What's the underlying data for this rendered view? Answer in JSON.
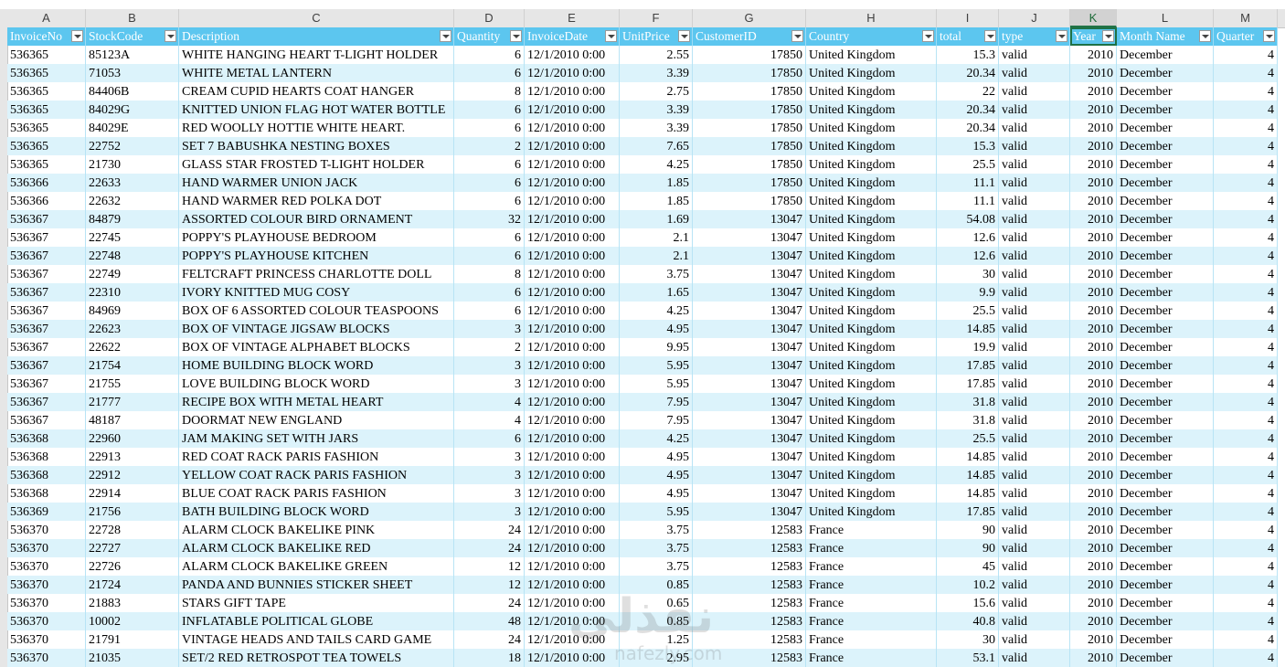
{
  "column_letters": [
    "A",
    "B",
    "C",
    "D",
    "E",
    "F",
    "G",
    "H",
    "I",
    "J",
    "K",
    "L",
    "M"
  ],
  "selected_column": "K",
  "headers": [
    "InvoiceNo",
    "StockCode",
    "Description",
    "Quantity",
    "InvoiceDate",
    "UnitPrice",
    "CustomerID",
    "Country",
    "total",
    "type",
    "Year",
    "Month Name",
    "Quarter"
  ],
  "rows": [
    [
      "536365",
      "85123A",
      "WHITE HANGING HEART T-LIGHT HOLDER",
      "6",
      "12/1/2010 0:00",
      "2.55",
      "17850",
      "United Kingdom",
      "15.3",
      "valid",
      "2010",
      "December",
      "4"
    ],
    [
      "536365",
      "71053",
      "WHITE METAL LANTERN",
      "6",
      "12/1/2010 0:00",
      "3.39",
      "17850",
      "United Kingdom",
      "20.34",
      "valid",
      "2010",
      "December",
      "4"
    ],
    [
      "536365",
      "84406B",
      "CREAM CUPID HEARTS COAT HANGER",
      "8",
      "12/1/2010 0:00",
      "2.75",
      "17850",
      "United Kingdom",
      "22",
      "valid",
      "2010",
      "December",
      "4"
    ],
    [
      "536365",
      "84029G",
      "KNITTED UNION FLAG HOT WATER BOTTLE",
      "6",
      "12/1/2010 0:00",
      "3.39",
      "17850",
      "United Kingdom",
      "20.34",
      "valid",
      "2010",
      "December",
      "4"
    ],
    [
      "536365",
      "84029E",
      "RED WOOLLY HOTTIE WHITE HEART.",
      "6",
      "12/1/2010 0:00",
      "3.39",
      "17850",
      "United Kingdom",
      "20.34",
      "valid",
      "2010",
      "December",
      "4"
    ],
    [
      "536365",
      "22752",
      "SET 7 BABUSHKA NESTING BOXES",
      "2",
      "12/1/2010 0:00",
      "7.65",
      "17850",
      "United Kingdom",
      "15.3",
      "valid",
      "2010",
      "December",
      "4"
    ],
    [
      "536365",
      "21730",
      "GLASS STAR FROSTED T-LIGHT HOLDER",
      "6",
      "12/1/2010 0:00",
      "4.25",
      "17850",
      "United Kingdom",
      "25.5",
      "valid",
      "2010",
      "December",
      "4"
    ],
    [
      "536366",
      "22633",
      "HAND WARMER UNION JACK",
      "6",
      "12/1/2010 0:00",
      "1.85",
      "17850",
      "United Kingdom",
      "11.1",
      "valid",
      "2010",
      "December",
      "4"
    ],
    [
      "536366",
      "22632",
      "HAND WARMER RED POLKA DOT",
      "6",
      "12/1/2010 0:00",
      "1.85",
      "17850",
      "United Kingdom",
      "11.1",
      "valid",
      "2010",
      "December",
      "4"
    ],
    [
      "536367",
      "84879",
      "ASSORTED COLOUR BIRD ORNAMENT",
      "32",
      "12/1/2010 0:00",
      "1.69",
      "13047",
      "United Kingdom",
      "54.08",
      "valid",
      "2010",
      "December",
      "4"
    ],
    [
      "536367",
      "22745",
      "POPPY'S PLAYHOUSE BEDROOM",
      "6",
      "12/1/2010 0:00",
      "2.1",
      "13047",
      "United Kingdom",
      "12.6",
      "valid",
      "2010",
      "December",
      "4"
    ],
    [
      "536367",
      "22748",
      "POPPY'S PLAYHOUSE KITCHEN",
      "6",
      "12/1/2010 0:00",
      "2.1",
      "13047",
      "United Kingdom",
      "12.6",
      "valid",
      "2010",
      "December",
      "4"
    ],
    [
      "536367",
      "22749",
      "FELTCRAFT PRINCESS CHARLOTTE DOLL",
      "8",
      "12/1/2010 0:00",
      "3.75",
      "13047",
      "United Kingdom",
      "30",
      "valid",
      "2010",
      "December",
      "4"
    ],
    [
      "536367",
      "22310",
      "IVORY KNITTED MUG COSY",
      "6",
      "12/1/2010 0:00",
      "1.65",
      "13047",
      "United Kingdom",
      "9.9",
      "valid",
      "2010",
      "December",
      "4"
    ],
    [
      "536367",
      "84969",
      "BOX OF 6 ASSORTED COLOUR TEASPOONS",
      "6",
      "12/1/2010 0:00",
      "4.25",
      "13047",
      "United Kingdom",
      "25.5",
      "valid",
      "2010",
      "December",
      "4"
    ],
    [
      "536367",
      "22623",
      "BOX OF VINTAGE JIGSAW BLOCKS",
      "3",
      "12/1/2010 0:00",
      "4.95",
      "13047",
      "United Kingdom",
      "14.85",
      "valid",
      "2010",
      "December",
      "4"
    ],
    [
      "536367",
      "22622",
      "BOX OF VINTAGE ALPHABET BLOCKS",
      "2",
      "12/1/2010 0:00",
      "9.95",
      "13047",
      "United Kingdom",
      "19.9",
      "valid",
      "2010",
      "December",
      "4"
    ],
    [
      "536367",
      "21754",
      "HOME BUILDING BLOCK WORD",
      "3",
      "12/1/2010 0:00",
      "5.95",
      "13047",
      "United Kingdom",
      "17.85",
      "valid",
      "2010",
      "December",
      "4"
    ],
    [
      "536367",
      "21755",
      "LOVE BUILDING BLOCK WORD",
      "3",
      "12/1/2010 0:00",
      "5.95",
      "13047",
      "United Kingdom",
      "17.85",
      "valid",
      "2010",
      "December",
      "4"
    ],
    [
      "536367",
      "21777",
      "RECIPE BOX WITH METAL HEART",
      "4",
      "12/1/2010 0:00",
      "7.95",
      "13047",
      "United Kingdom",
      "31.8",
      "valid",
      "2010",
      "December",
      "4"
    ],
    [
      "536367",
      "48187",
      "DOORMAT NEW ENGLAND",
      "4",
      "12/1/2010 0:00",
      "7.95",
      "13047",
      "United Kingdom",
      "31.8",
      "valid",
      "2010",
      "December",
      "4"
    ],
    [
      "536368",
      "22960",
      "JAM MAKING SET WITH JARS",
      "6",
      "12/1/2010 0:00",
      "4.25",
      "13047",
      "United Kingdom",
      "25.5",
      "valid",
      "2010",
      "December",
      "4"
    ],
    [
      "536368",
      "22913",
      "RED COAT RACK PARIS FASHION",
      "3",
      "12/1/2010 0:00",
      "4.95",
      "13047",
      "United Kingdom",
      "14.85",
      "valid",
      "2010",
      "December",
      "4"
    ],
    [
      "536368",
      "22912",
      "YELLOW COAT RACK PARIS FASHION",
      "3",
      "12/1/2010 0:00",
      "4.95",
      "13047",
      "United Kingdom",
      "14.85",
      "valid",
      "2010",
      "December",
      "4"
    ],
    [
      "536368",
      "22914",
      "BLUE COAT RACK PARIS FASHION",
      "3",
      "12/1/2010 0:00",
      "4.95",
      "13047",
      "United Kingdom",
      "14.85",
      "valid",
      "2010",
      "December",
      "4"
    ],
    [
      "536369",
      "21756",
      "BATH BUILDING BLOCK WORD",
      "3",
      "12/1/2010 0:00",
      "5.95",
      "13047",
      "United Kingdom",
      "17.85",
      "valid",
      "2010",
      "December",
      "4"
    ],
    [
      "536370",
      "22728",
      "ALARM CLOCK BAKELIKE PINK",
      "24",
      "12/1/2010 0:00",
      "3.75",
      "12583",
      "France",
      "90",
      "valid",
      "2010",
      "December",
      "4"
    ],
    [
      "536370",
      "22727",
      "ALARM CLOCK BAKELIKE RED",
      "24",
      "12/1/2010 0:00",
      "3.75",
      "12583",
      "France",
      "90",
      "valid",
      "2010",
      "December",
      "4"
    ],
    [
      "536370",
      "22726",
      "ALARM CLOCK BAKELIKE GREEN",
      "12",
      "12/1/2010 0:00",
      "3.75",
      "12583",
      "France",
      "45",
      "valid",
      "2010",
      "December",
      "4"
    ],
    [
      "536370",
      "21724",
      "PANDA AND BUNNIES STICKER SHEET",
      "12",
      "12/1/2010 0:00",
      "0.85",
      "12583",
      "France",
      "10.2",
      "valid",
      "2010",
      "December",
      "4"
    ],
    [
      "536370",
      "21883",
      "STARS GIFT TAPE",
      "24",
      "12/1/2010 0:00",
      "0.65",
      "12583",
      "France",
      "15.6",
      "valid",
      "2010",
      "December",
      "4"
    ],
    [
      "536370",
      "10002",
      "INFLATABLE POLITICAL GLOBE",
      "48",
      "12/1/2010 0:00",
      "0.85",
      "12583",
      "France",
      "40.8",
      "valid",
      "2010",
      "December",
      "4"
    ],
    [
      "536370",
      "21791",
      "VINTAGE HEADS AND TAILS CARD GAME",
      "24",
      "12/1/2010 0:00",
      "1.25",
      "12583",
      "France",
      "30",
      "valid",
      "2010",
      "December",
      "4"
    ],
    [
      "536370",
      "21035",
      "SET/2 RED RETROSPOT TEA TOWELS",
      "18",
      "12/1/2010 0:00",
      "2.95",
      "12583",
      "France",
      "53.1",
      "valid",
      "2010",
      "December",
      "4"
    ]
  ],
  "right_aligned_columns": [
    3,
    5,
    6,
    8,
    10,
    12
  ],
  "watermark": {
    "main": "نفذلي",
    "sub": "nafezly.com"
  },
  "colors": {
    "header_fill": "#5cc6ef",
    "band_fill": "#dcf3fb",
    "selection": "#217346"
  }
}
